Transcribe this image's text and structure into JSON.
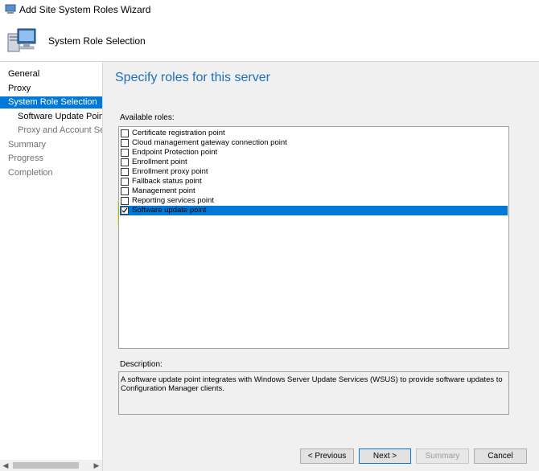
{
  "window": {
    "title": "Add Site System Roles Wizard"
  },
  "header": {
    "page_name": "System Role Selection"
  },
  "nav": {
    "items": [
      {
        "label": "General",
        "state": "done"
      },
      {
        "label": "Proxy",
        "state": "done"
      },
      {
        "label": "System Role Selection",
        "state": "active"
      },
      {
        "label": "Software Update Point",
        "state": "sub-done"
      },
      {
        "label": "Proxy and Account Settin",
        "state": "sub-pending"
      },
      {
        "label": "Summary",
        "state": "pending"
      },
      {
        "label": "Progress",
        "state": "pending"
      },
      {
        "label": "Completion",
        "state": "pending"
      }
    ]
  },
  "main": {
    "heading": "Specify roles for this server",
    "available_label": "Available roles:",
    "roles": [
      {
        "label": "Certificate registration point",
        "checked": false
      },
      {
        "label": "Cloud management gateway connection point",
        "checked": false
      },
      {
        "label": "Endpoint Protection point",
        "checked": false
      },
      {
        "label": "Enrollment point",
        "checked": false
      },
      {
        "label": "Enrollment proxy point",
        "checked": false
      },
      {
        "label": "Fallback status point",
        "checked": false
      },
      {
        "label": "Management point",
        "checked": false
      },
      {
        "label": "Reporting services point",
        "checked": false
      },
      {
        "label": "Software update point",
        "checked": true,
        "selected": true
      }
    ],
    "description_label": "Description:",
    "description": "A software update point integrates with Windows Server Update Services (WSUS) to provide software updates to Configuration Manager clients."
  },
  "buttons": {
    "previous": "< Previous",
    "next": "Next >",
    "summary": "Summary",
    "cancel": "Cancel"
  },
  "colors": {
    "accent": "#0078d7",
    "heading": "#1e6fb5",
    "highlight": "#f4ee1c"
  }
}
